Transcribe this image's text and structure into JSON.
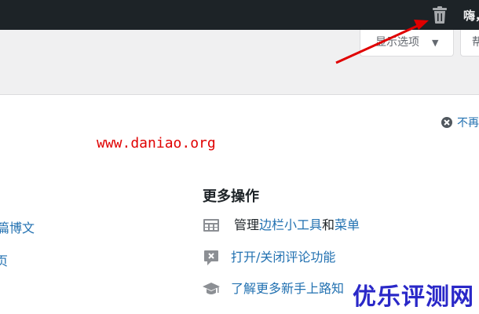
{
  "adminbar": {
    "greeting": "嗨，"
  },
  "screen_options": {
    "label": "显示选项",
    "caret": "▼",
    "help_label": "帮"
  },
  "welcome": {
    "dismiss_label": "不再",
    "watermark": "www.daniao.org",
    "left_links": [
      "篇博文",
      "页"
    ],
    "more_actions": {
      "heading": "更多操作",
      "manage_prefix": "管理",
      "widgets_link": "边栏小工具",
      "and_text": "和",
      "menus_link": "菜单",
      "comments_link": "打开/关闭评论功能",
      "learn_more_link": "了解更多新手上路知"
    }
  },
  "brand_watermark": "优乐评测网",
  "colors": {
    "adminbar": "#1d2327",
    "link": "#2271b1",
    "arrow": "#e00000",
    "brand": "#2a28c8"
  },
  "icons": [
    "trash-icon",
    "dismiss-circle-icon",
    "layout-icon",
    "comment-x-icon",
    "graduation-cap-icon"
  ]
}
